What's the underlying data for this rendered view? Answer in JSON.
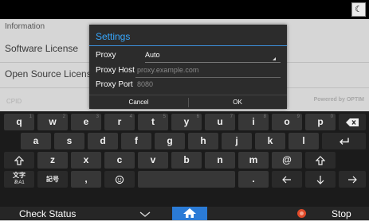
{
  "background": {
    "header_label": "Information",
    "items": [
      "Software License",
      "Open Source Licenses"
    ],
    "faint_left": "CPID",
    "faint_right": "Powered by OPTIM"
  },
  "dialog": {
    "title": "Settings",
    "proxy_label": "Proxy",
    "proxy_value": "Auto",
    "host_label": "Proxy Host",
    "host_placeholder": "proxy.example.com",
    "port_label": "Proxy Port",
    "port_placeholder": "8080",
    "cancel_label": "Cancel",
    "ok_label": "OK"
  },
  "keyboard": {
    "row1": [
      "q",
      "w",
      "e",
      "r",
      "t",
      "y",
      "u",
      "i",
      "o",
      "p"
    ],
    "row1_secondary": [
      "1",
      "2",
      "3",
      "4",
      "5",
      "6",
      "7",
      "8",
      "9",
      "0"
    ],
    "row2": [
      "a",
      "s",
      "d",
      "f",
      "g",
      "h",
      "j",
      "k",
      "l"
    ],
    "row3": [
      "z",
      "x",
      "c",
      "v",
      "b",
      "n",
      "m",
      "@"
    ],
    "lang_key_top": "文字",
    "lang_key_bottom": "あA1",
    "symbol_key": "記号",
    "comma_key": ",",
    "period_key": "."
  },
  "bottombar": {
    "check_status": "Check Status",
    "stop": "Stop"
  },
  "colors": {
    "accent_blue": "#37a8ff",
    "home_blue": "#2b7bd6",
    "stop_red": "#e04a2a"
  }
}
